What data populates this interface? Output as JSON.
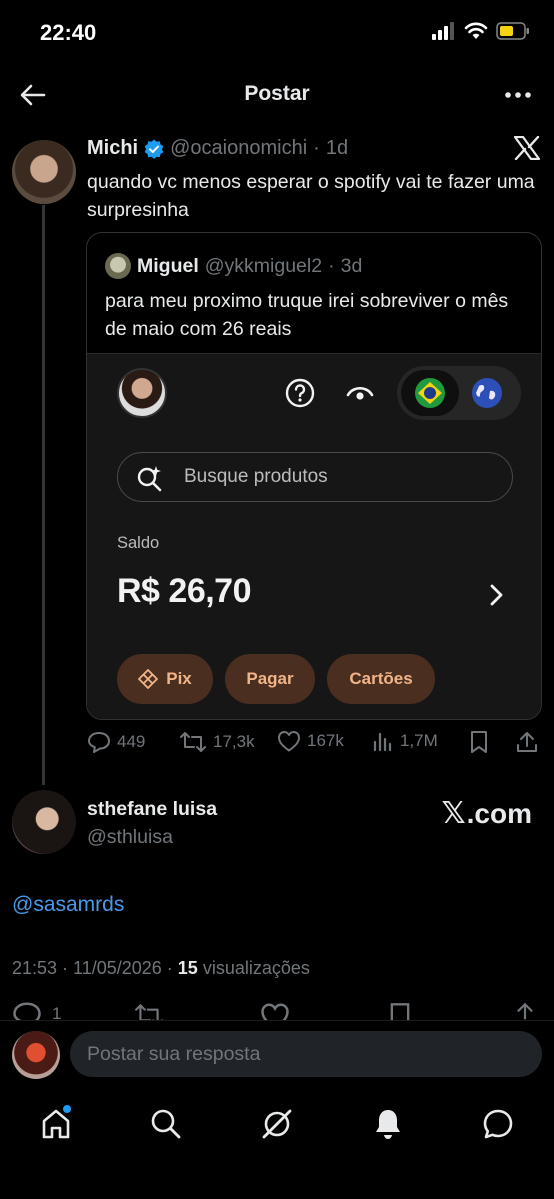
{
  "status_bar": {
    "time": "22:40"
  },
  "header": {
    "title": "Postar"
  },
  "post": {
    "name": "Michi",
    "handle": "@ocaionomichi",
    "separator": "·",
    "age": "1d",
    "text": "quando vc menos esperar o spotify vai te fazer uma surpresinha"
  },
  "quote": {
    "name": "Miguel",
    "handle": "@ykkmiguel2",
    "separator": "·",
    "age": "3d",
    "text": "para meu proximo truque irei sobreviver o mês de maio com 26 reais",
    "embed": {
      "search_placeholder": "Busque produtos",
      "saldo_label": "Saldo",
      "saldo_value": "R$ 26,70",
      "buttons": {
        "pix": "Pix",
        "pagar": "Pagar",
        "cartoes": "Cartões"
      },
      "colors": {
        "background": "#161616",
        "pill": "#4a2e20",
        "pill_text": "#f0b488"
      }
    }
  },
  "actions": {
    "replies": "449",
    "reposts": "17,3k",
    "likes": "167k",
    "views": "1,7M"
  },
  "reply": {
    "name": "sthefane luisa",
    "handle": "@sthluisa",
    "watermark_x": "𝕏",
    "watermark_domain": ".com",
    "mention": "@sasamrds",
    "timestamp": "21:53 · 11/05/2026 · ",
    "views_count": "15",
    "views_label": " visualizações",
    "partial_reply_count": "1"
  },
  "compose": {
    "placeholder": "Postar sua resposta"
  },
  "colors": {
    "accent": "#1d9bf0",
    "mention": "#4a99e9",
    "muted": "#71767b"
  }
}
